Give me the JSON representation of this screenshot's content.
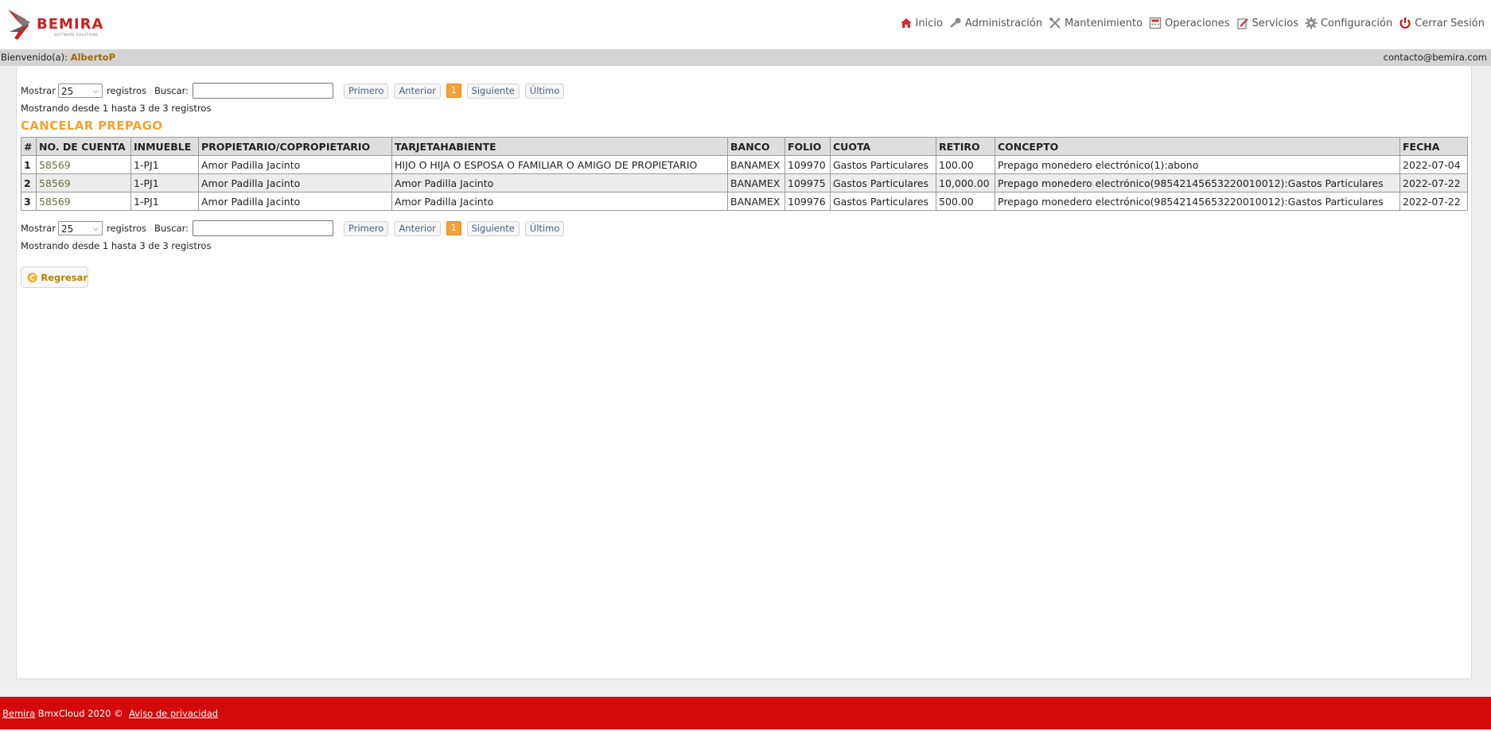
{
  "brand": {
    "name": "BEMIRA",
    "tagline": "SOFTWARE SOLUTIONS",
    "color": "#cc2222"
  },
  "nav": {
    "items": [
      {
        "label": "Inicio",
        "icon": "home-icon"
      },
      {
        "label": "Administración",
        "icon": "key-icon"
      },
      {
        "label": "Mantenimiento",
        "icon": "tools-icon"
      },
      {
        "label": "Operaciones",
        "icon": "calculator-icon"
      },
      {
        "label": "Servicios",
        "icon": "services-icon"
      },
      {
        "label": "Configuración",
        "icon": "gear-icon"
      },
      {
        "label": "Cerrar Sesión",
        "icon": "power-icon"
      }
    ]
  },
  "welcome": {
    "prefix": "Bienvenido(a):",
    "user": "AlbertoP",
    "contact": "contacto@bemira.com"
  },
  "controls": {
    "show_label": "Mostrar",
    "show_value": "25",
    "records_label": "registros",
    "search_label": "Buscar:",
    "search_value": "",
    "pager": {
      "first": "Primero",
      "prev": "Anterior",
      "current": "1",
      "next": "Siguiente",
      "last": "Último"
    },
    "info": "Mostrando desde 1 hasta 3 de 3 registros"
  },
  "page_title": "CANCELAR PREPAGO",
  "table": {
    "headers": [
      "#",
      "NO. DE CUENTA",
      "INMUEBLE",
      "PROPIETARIO/COPROPIETARIO",
      "TARJETAHABIENTE",
      "BANCO",
      "FOLIO",
      "CUOTA",
      "RETIRO",
      "CONCEPTO",
      "FECHA"
    ],
    "rows": [
      [
        "1",
        "58569",
        "1-PJ1",
        "Amor Padilla Jacinto",
        "HIJO O HIJA O ESPOSA O FAMILIAR O AMIGO DE PROPIETARIO",
        "BANAMEX",
        "109970",
        "Gastos Particulares",
        "100.00",
        "Prepago monedero electrónico(1):abono",
        "2022-07-04"
      ],
      [
        "2",
        "58569",
        "1-PJ1",
        "Amor Padilla Jacinto",
        "Amor Padilla Jacinto",
        "BANAMEX",
        "109975",
        "Gastos Particulares",
        "10,000.00",
        "Prepago monedero electrónico(98542145653220010012):Gastos Particulares",
        "2022-07-22"
      ],
      [
        "3",
        "58569",
        "1-PJ1",
        "Amor Padilla Jacinto",
        "Amor Padilla Jacinto",
        "BANAMEX",
        "109976",
        "Gastos Particulares",
        "500.00",
        "Prepago monedero electrónico(98542145653220010012):Gastos Particulares",
        "2022-07-22"
      ]
    ]
  },
  "back_button": {
    "label": "Regresar",
    "icon": "back-circle-icon"
  },
  "footer": {
    "brand_link": "Bemira",
    "text": "BmxCloud 2020 ©",
    "privacy_link": "Aviso de privacidad"
  },
  "colors": {
    "accent": "#f3a233",
    "footer_bg": "#d20a0a",
    "user_name": "#a26a00"
  }
}
